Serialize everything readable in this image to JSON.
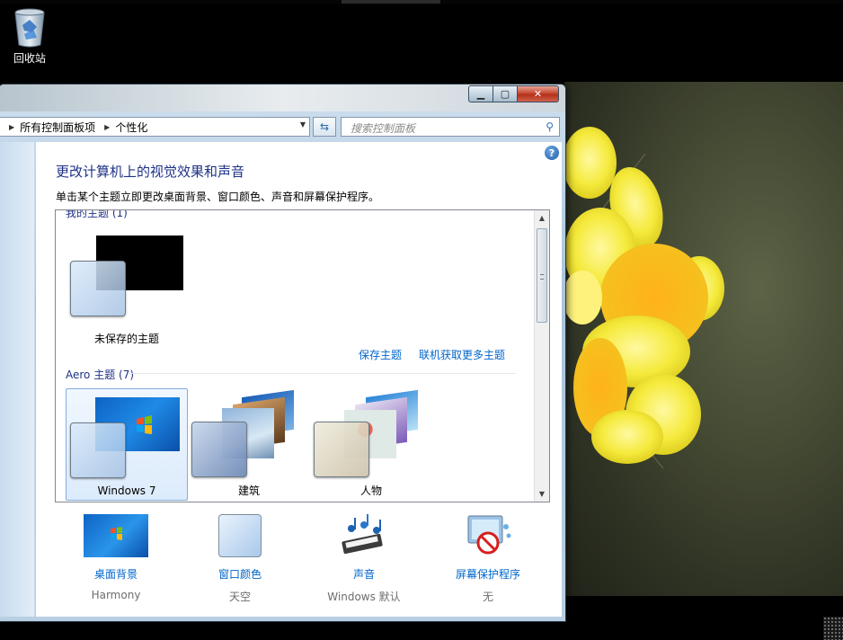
{
  "desktop": {
    "recycle_bin": {
      "label": "回收站",
      "icon": "recycle-bin-icon"
    }
  },
  "window": {
    "caption_buttons": {
      "minimize": "minimize-icon",
      "maximize": "maximize-icon",
      "close": "close-icon"
    },
    "address": {
      "breadcrumb": [
        "所有控制面板项",
        "个性化"
      ],
      "refresh_icon": "refresh-icon"
    },
    "search": {
      "placeholder": "搜索控制面板",
      "icon": "search-icon"
    },
    "help_label": "?",
    "title": "更改计算机上的视觉效果和声音",
    "subtitle": "单击某个主题立即更改桌面背景、窗口颜色、声音和屏幕保护程序。",
    "my_themes": {
      "header": "我的主题 (1)",
      "items": [
        {
          "name": "未保存的主题"
        }
      ],
      "links": {
        "save": "保存主题",
        "get_more": "联机获取更多主题"
      }
    },
    "aero_themes": {
      "header": "Aero 主题 (7)",
      "items": [
        {
          "name": "Windows 7",
          "selected": true
        },
        {
          "name": "建筑",
          "selected": false
        },
        {
          "name": "人物",
          "selected": false
        }
      ]
    },
    "settings": [
      {
        "label": "桌面背景",
        "value": "Harmony",
        "icon": "desktop-background-icon"
      },
      {
        "label": "窗口颜色",
        "value": "天空",
        "icon": "window-color-icon"
      },
      {
        "label": "声音",
        "value": "Windows 默认",
        "icon": "sounds-icon"
      },
      {
        "label": "屏幕保护程序",
        "value": "无",
        "icon": "screensaver-icon"
      }
    ]
  },
  "colors": {
    "link_blue": "#0066cc",
    "heading_blue": "#1e3287",
    "selection_border": "#84acdd"
  }
}
